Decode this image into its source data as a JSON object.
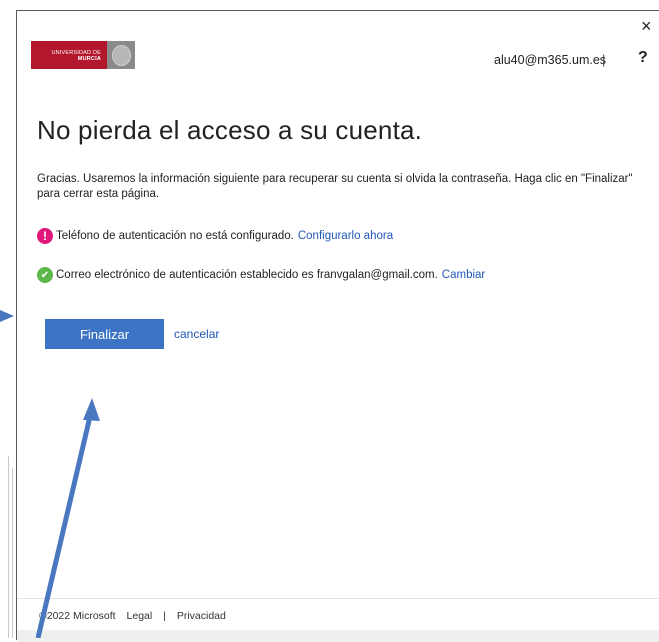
{
  "header": {
    "logo": {
      "line1": "UNIVERSIDAD DE",
      "line2": "MURCIA"
    },
    "user_email": "alu40@m365.um.es",
    "separator": "|",
    "help": "?",
    "close": "×"
  },
  "main": {
    "title": "No pierda el acceso a su cuenta.",
    "intro": "Gracias. Usaremos la información siguiente para recuperar su cuenta si olvida la contraseña. Haga clic en \"Finalizar\" para cerrar esta página.",
    "phone_status": {
      "icon": "warning-icon",
      "text": "Teléfono de autenticación no está configurado.",
      "link": "Configurarlo ahora"
    },
    "email_status": {
      "icon": "check-icon",
      "text": "Correo electrónico de autenticación establecido es franvgalan@gmail.com.",
      "link": "Cambiar"
    },
    "finish_label": "Finalizar",
    "cancel_label": "cancelar"
  },
  "footer": {
    "copyright": "©2022 Microsoft",
    "legal": "Legal",
    "separator": "|",
    "privacy": "Privacidad"
  },
  "colors": {
    "accent": "#3c73c4",
    "brand_red": "#b3172d",
    "warning": "#e0187a",
    "success": "#5cb84a",
    "annotation_arrow": "#4a78c0"
  }
}
